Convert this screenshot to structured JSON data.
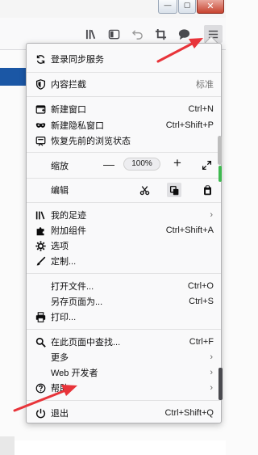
{
  "window": {
    "minimize_glyph": "—",
    "maximize_glyph": "▢",
    "close_glyph": "✕"
  },
  "toolbar": {
    "icons": [
      "library-icon",
      "sidebar-icon",
      "back-arrow-icon",
      "crop-icon",
      "chat-icon",
      "hamburger-menu-icon"
    ]
  },
  "menu": {
    "sync": "登录同步服务",
    "content_blocking": "内容拦截",
    "content_blocking_value": "标准",
    "new_window": "新建窗口",
    "new_window_shortcut": "Ctrl+N",
    "new_private_window": "新建隐私窗口",
    "new_private_window_shortcut": "Ctrl+Shift+P",
    "restore_session": "恢复先前的浏览状态",
    "zoom_label": "缩放",
    "zoom_minus": "—",
    "zoom_value": "100%",
    "zoom_plus": "+",
    "edit_label": "编辑",
    "library": "我的足迹",
    "addons": "附加组件",
    "addons_shortcut": "Ctrl+Shift+A",
    "options": "选项",
    "customize": "定制...",
    "open_file": "打开文件...",
    "open_file_shortcut": "Ctrl+O",
    "save_page": "另存页面为...",
    "save_page_shortcut": "Ctrl+S",
    "print": "打印...",
    "find": "在此页面中查找...",
    "find_shortcut": "Ctrl+F",
    "more": "更多",
    "web_developer": "Web 开发者",
    "help": "帮助",
    "exit": "退出",
    "exit_shortcut": "Ctrl+Shift+Q",
    "chevron": "›"
  },
  "colors": {
    "annotation_red": "#e8343a",
    "accent_blue": "#1b57a5"
  }
}
